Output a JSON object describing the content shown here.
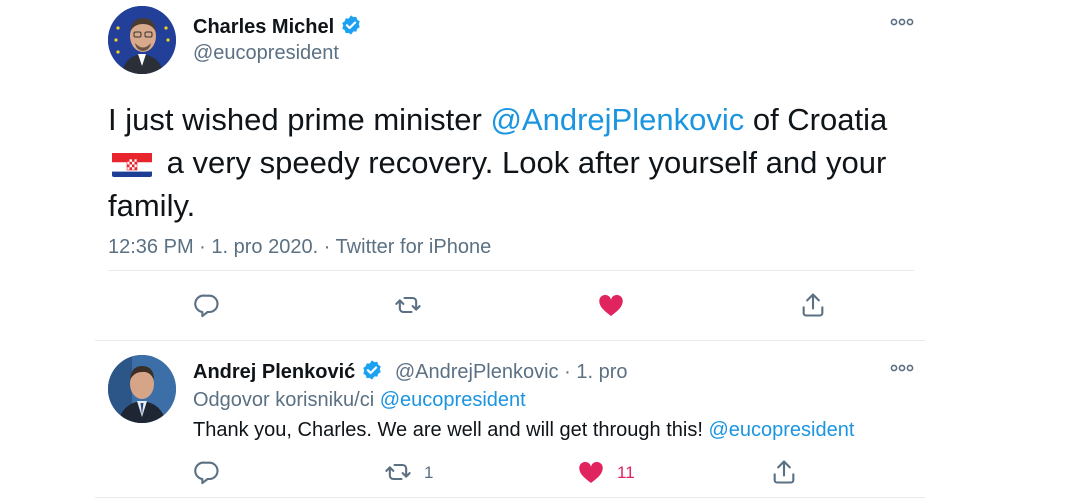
{
  "colors": {
    "link": "#1b95e0",
    "muted": "#5b7083",
    "like_red": "#e0245e",
    "verified_blue": "#1da1f2",
    "divider": "#e6ecf0"
  },
  "main_tweet": {
    "author_name": "Charles Michel",
    "handle": "@eucopresident",
    "more_icon": "more-dots-icon",
    "text_part1": "I just wished prime minister ",
    "mention": "@AndrejPlenkovic",
    "text_part2": " of Croatia ",
    "flag_icon": "croatia-flag-icon",
    "text_part3": " a very speedy recovery. Look after yourself and your family.",
    "time": "12:36 PM",
    "date": "1. pro 2020.",
    "source": "Twitter for iPhone",
    "sep": " · ",
    "actions": {
      "reply_icon": "reply-icon",
      "retweet_icon": "retweet-icon",
      "like_icon": "heart-filled-icon",
      "share_icon": "share-icon"
    }
  },
  "reply_tweet": {
    "author_name": "Andrej Plenković",
    "handle": "@AndrejPlenkovic",
    "date": "1. pro",
    "sep": " · ",
    "replying_prefix": "Odgovor korisniku/ci ",
    "replying_to": "@eucopresident",
    "text": "Thank you, Charles. We are well and will get through this! ",
    "text_mention": "@eucopresident",
    "retweet_count": "1",
    "like_count": "11"
  }
}
